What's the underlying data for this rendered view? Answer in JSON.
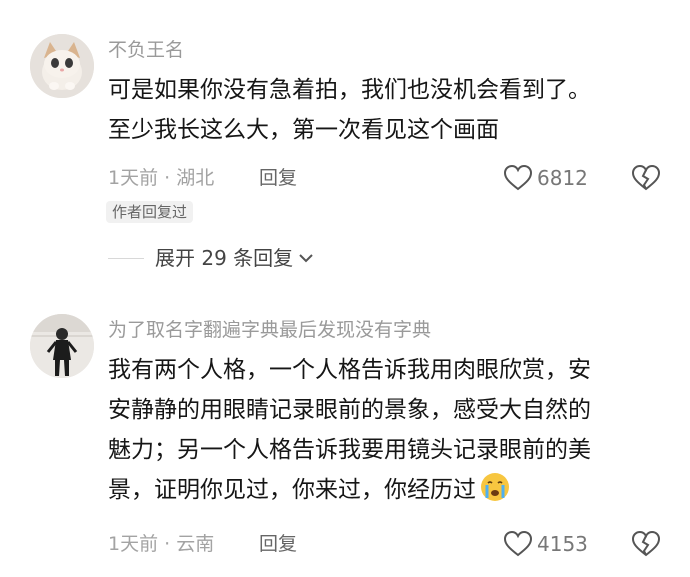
{
  "comments": [
    {
      "username": "不负王名",
      "text_lines": [
        "可是如果你没有急着拍，我们也没机会看到了。",
        "至少我长这么大，第一次看见这个画面"
      ],
      "time": "1天前",
      "location": "湖北",
      "reply_label": "回复",
      "likes": "6812",
      "author_badge": "作者回复过",
      "expand_label": "展开 29 条回复"
    },
    {
      "username": "为了取名字翻遍字典最后发现没有字典",
      "text_lines": [
        "我有两个人格，一个人格告诉我用肉眼欣赏，安",
        "安静静的用眼睛记录眼前的景象，感受大自然的",
        "魅力；另一个人格告诉我要用镜头记录眼前的美",
        "景，证明你见过，你来过，你经历过"
      ],
      "time": "1天前",
      "location": "云南",
      "reply_label": "回复",
      "likes": "4153"
    }
  ],
  "meta_separator": " · ",
  "icons": {
    "like": "heart-outline-icon",
    "dislike": "broken-heart-icon",
    "expand": "chevron-down-icon",
    "emoji": "crying-face-emoji"
  },
  "colors": {
    "username": "#9a9a9a",
    "meta": "#a3a3a3",
    "text": "#161616"
  }
}
